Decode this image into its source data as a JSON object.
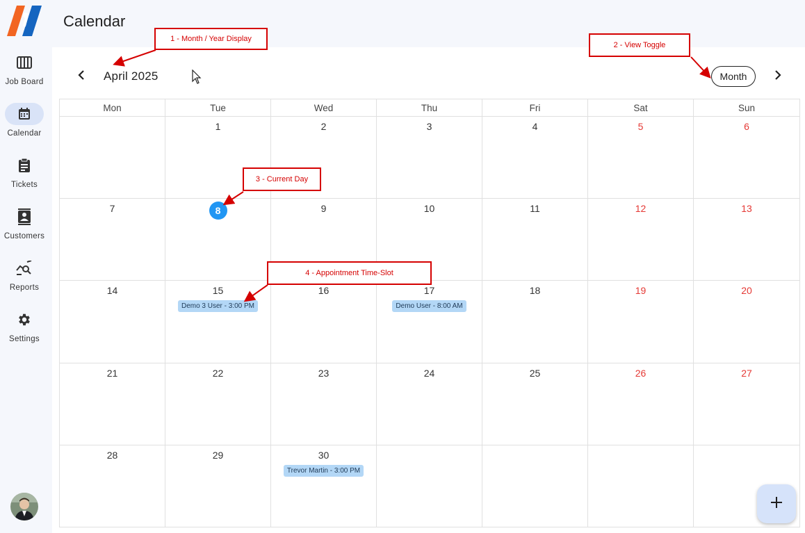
{
  "app": {
    "title": "Calendar",
    "colors": {
      "accent": "#2196f3",
      "weekend": "#e53935",
      "event_bg": "#b3d7f6",
      "nav_active": "#d9e3f7",
      "annotation": "#d50000"
    }
  },
  "sidebar": {
    "items": [
      {
        "label": "Job Board",
        "icon": "job-board-icon"
      },
      {
        "label": "Calendar",
        "icon": "calendar-icon"
      },
      {
        "label": "Tickets",
        "icon": "clipboard-icon"
      },
      {
        "label": "Customers",
        "icon": "contacts-icon"
      },
      {
        "label": "Reports",
        "icon": "query-stats-icon"
      },
      {
        "label": "Settings",
        "icon": "gear-icon"
      }
    ],
    "active": "Calendar"
  },
  "calendar": {
    "month_label": "April 2025",
    "view_toggle": "Month",
    "days_of_week": [
      "Mon",
      "Tue",
      "Wed",
      "Thu",
      "Fri",
      "Sat",
      "Sun"
    ],
    "weeks": [
      [
        {
          "day": ""
        },
        {
          "day": "1"
        },
        {
          "day": "2"
        },
        {
          "day": "3"
        },
        {
          "day": "4"
        },
        {
          "day": "5",
          "weekend": true
        },
        {
          "day": "6",
          "weekend": true
        }
      ],
      [
        {
          "day": "7"
        },
        {
          "day": "8",
          "today": true
        },
        {
          "day": "9"
        },
        {
          "day": "10"
        },
        {
          "day": "11"
        },
        {
          "day": "12",
          "weekend": true
        },
        {
          "day": "13",
          "weekend": true
        }
      ],
      [
        {
          "day": "14"
        },
        {
          "day": "15",
          "events": [
            "Demo 3 User - 3:00 PM"
          ]
        },
        {
          "day": "16"
        },
        {
          "day": "17",
          "events": [
            "Demo User - 8:00 AM"
          ]
        },
        {
          "day": "18"
        },
        {
          "day": "19",
          "weekend": true
        },
        {
          "day": "20",
          "weekend": true
        }
      ],
      [
        {
          "day": "21"
        },
        {
          "day": "22"
        },
        {
          "day": "23"
        },
        {
          "day": "24"
        },
        {
          "day": "25"
        },
        {
          "day": "26",
          "weekend": true
        },
        {
          "day": "27",
          "weekend": true
        }
      ],
      [
        {
          "day": "28"
        },
        {
          "day": "29"
        },
        {
          "day": "30",
          "events": [
            "Trevor Martin - 3:00 PM"
          ]
        },
        {
          "day": ""
        },
        {
          "day": ""
        },
        {
          "day": ""
        },
        {
          "day": ""
        }
      ]
    ]
  },
  "annotations": [
    "1 -  Month / Year Display",
    "2 - View Toggle",
    "3 - Current Day",
    "4 - Appointment Time-Slot"
  ]
}
